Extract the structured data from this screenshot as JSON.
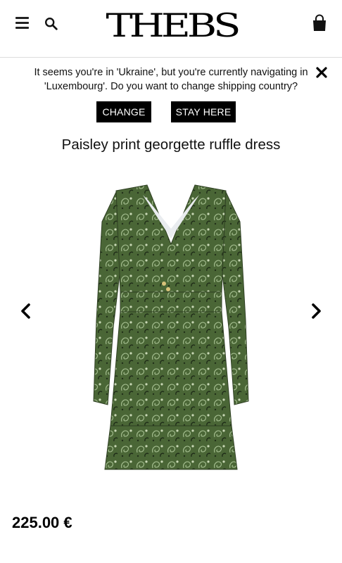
{
  "header": {
    "logo_text": "THEBS",
    "icons": {
      "menu": "hamburger-menu-icon",
      "search": "search-icon",
      "cart": "shopping-bag-icon"
    }
  },
  "banner": {
    "message": "It seems you're in 'Ukraine', but you're currently navigating in 'Luxembourg'. Do you want to change shipping country?",
    "change_label": "CHANGE",
    "stay_label": "STAY HERE",
    "close_icon": "close-icon"
  },
  "product": {
    "title": "Paisley print georgette ruffle dress",
    "price": "225.00 €",
    "image_alt": "Green paisley print long-sleeve dress"
  },
  "carousel": {
    "prev_icon": "chevron-left-icon",
    "next_icon": "chevron-right-icon"
  },
  "colors": {
    "button_bg": "#000000",
    "button_text": "#ffffff",
    "dress_green": "#4f6b3a"
  }
}
